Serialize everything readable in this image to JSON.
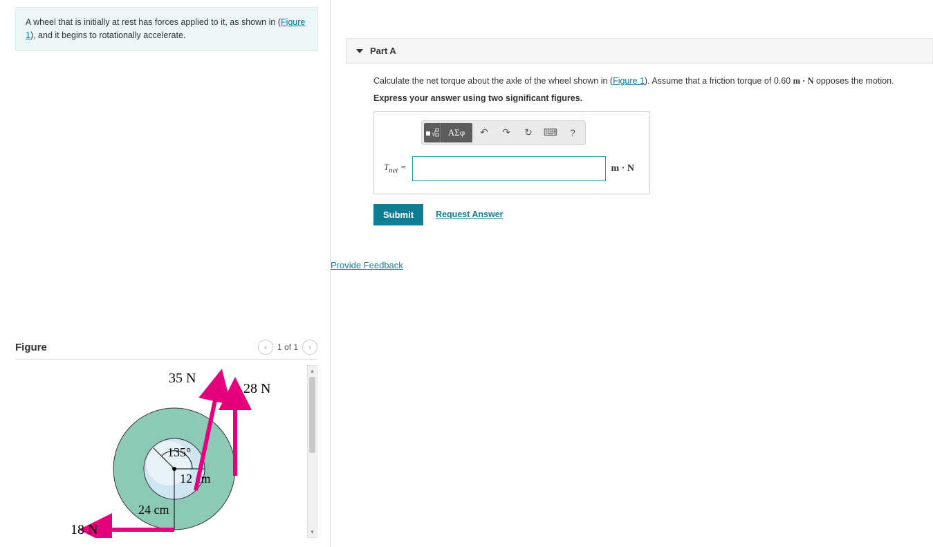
{
  "problem": {
    "text_before": "A wheel that is initially at rest has forces applied to it, as shown in (",
    "figure_link": "Figure 1",
    "text_after": "), and it begins to rotationally accelerate."
  },
  "figure": {
    "title": "Figure",
    "counter": "1 of 1",
    "labels": {
      "force_35": "35 N",
      "force_28": "28 N",
      "force_18": "18 N",
      "angle": "135°",
      "radius_inner": "12 cm",
      "radius_outer": "24 cm"
    }
  },
  "part": {
    "title": "Part A",
    "question_before": "Calculate the net torque about the axle of the wheel shown in (",
    "question_link": "Figure 1",
    "question_after": "). Assume that a friction torque of 0.60 ",
    "question_unit": "m · N",
    "question_tail": " opposes the motion.",
    "instruction": "Express your answer using two significant figures.",
    "answer_label": "Tnet =",
    "answer_unit": "m · N",
    "toolbar": {
      "templates": "■√□",
      "greek": "ΑΣφ",
      "undo": "↶",
      "redo": "↷",
      "reset": "↻",
      "keyboard": "⌨",
      "help": "?"
    }
  },
  "actions": {
    "submit": "Submit",
    "request": "Request Answer",
    "feedback": "Provide Feedback"
  }
}
